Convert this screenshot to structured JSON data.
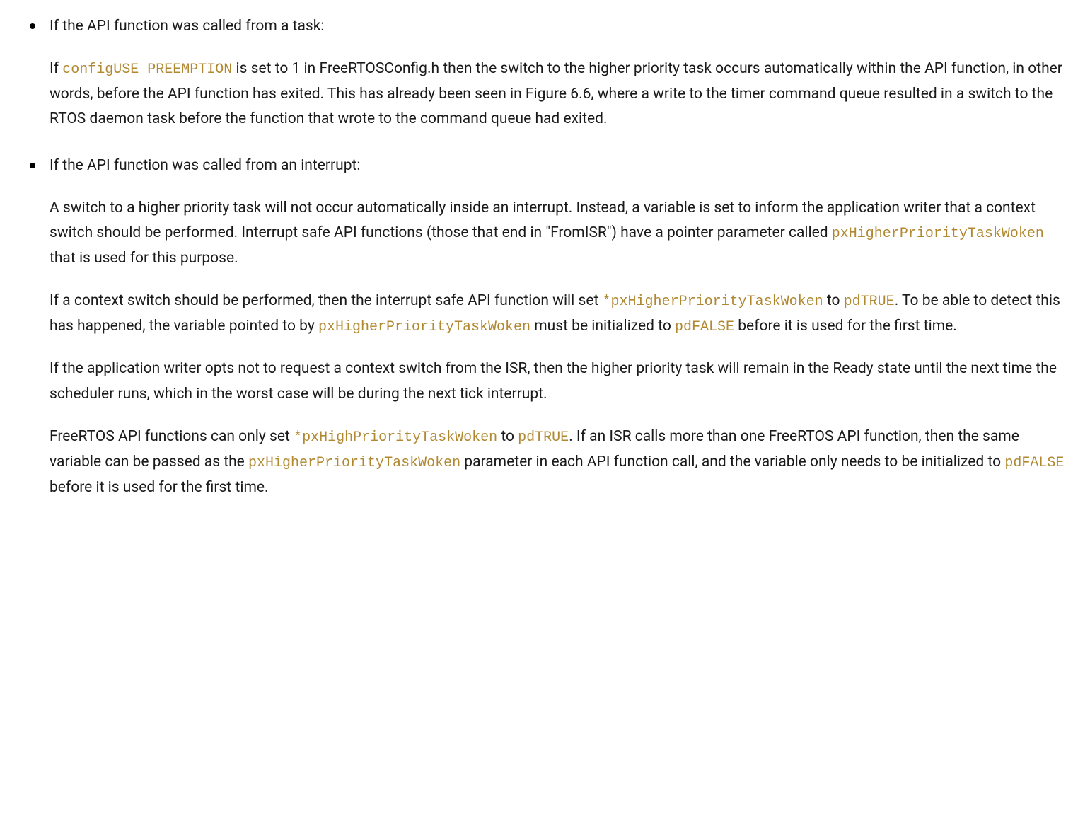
{
  "bullets": [
    {
      "header": "If the API function was called from a task:",
      "paras": [
        {
          "segments": [
            {
              "type": "text",
              "value": "If "
            },
            {
              "type": "code",
              "value": "configUSE_PREEMPTION"
            },
            {
              "type": "text",
              "value": " is set to 1 in FreeRTOSConfig.h then the switch to the higher priority task occurs automatically within the API function, in other words, before the API function has exited. This has already been seen in Figure 6.6, where a write to the timer command queue resulted in a switch to the RTOS daemon task before the function that wrote to the command queue had exited."
            }
          ]
        }
      ]
    },
    {
      "header": "If the API function was called from an interrupt:",
      "paras": [
        {
          "segments": [
            {
              "type": "text",
              "value": "A switch to a higher priority task will not occur automatically inside an interrupt. Instead, a variable is set to inform the application writer that a context switch should be performed. Interrupt safe API functions (those that end in \"FromISR\") have a pointer parameter called "
            },
            {
              "type": "code",
              "value": "pxHigherPriorityTaskWoken"
            },
            {
              "type": "text",
              "value": " that is used for this purpose."
            }
          ]
        },
        {
          "segments": [
            {
              "type": "text",
              "value": "If a context switch should be performed, then the interrupt safe API function will set "
            },
            {
              "type": "code",
              "value": "*pxHigherPriorityTaskWoken"
            },
            {
              "type": "text",
              "value": " to "
            },
            {
              "type": "code",
              "value": "pdTRUE"
            },
            {
              "type": "text",
              "value": ". To be able to detect this has happened, the variable pointed to by "
            },
            {
              "type": "code",
              "value": "pxHigherPriorityTaskWoken"
            },
            {
              "type": "text",
              "value": " must be initialized to "
            },
            {
              "type": "code",
              "value": "pdFALSE"
            },
            {
              "type": "text",
              "value": " before it is used for the first time."
            }
          ]
        },
        {
          "segments": [
            {
              "type": "text",
              "value": "If the application writer opts not to request a context switch from the ISR, then the higher priority task will remain in the Ready state until the next time the scheduler runs, which in the worst case will be during the next tick interrupt."
            }
          ]
        },
        {
          "segments": [
            {
              "type": "text",
              "value": "FreeRTOS API functions can only set "
            },
            {
              "type": "code",
              "value": "*pxHighPriorityTaskWoken"
            },
            {
              "type": "text",
              "value": " to "
            },
            {
              "type": "code",
              "value": "pdTRUE"
            },
            {
              "type": "text",
              "value": ". If an ISR calls more than one FreeRTOS API function, then the same variable can be passed as the "
            },
            {
              "type": "code",
              "value": "pxHigherPriorityTaskWoken"
            },
            {
              "type": "text",
              "value": " parameter in each API function call, and the variable only needs to be initialized to "
            },
            {
              "type": "code",
              "value": "pdFALSE"
            },
            {
              "type": "text",
              "value": " before it is used for the first time."
            }
          ]
        }
      ]
    }
  ]
}
